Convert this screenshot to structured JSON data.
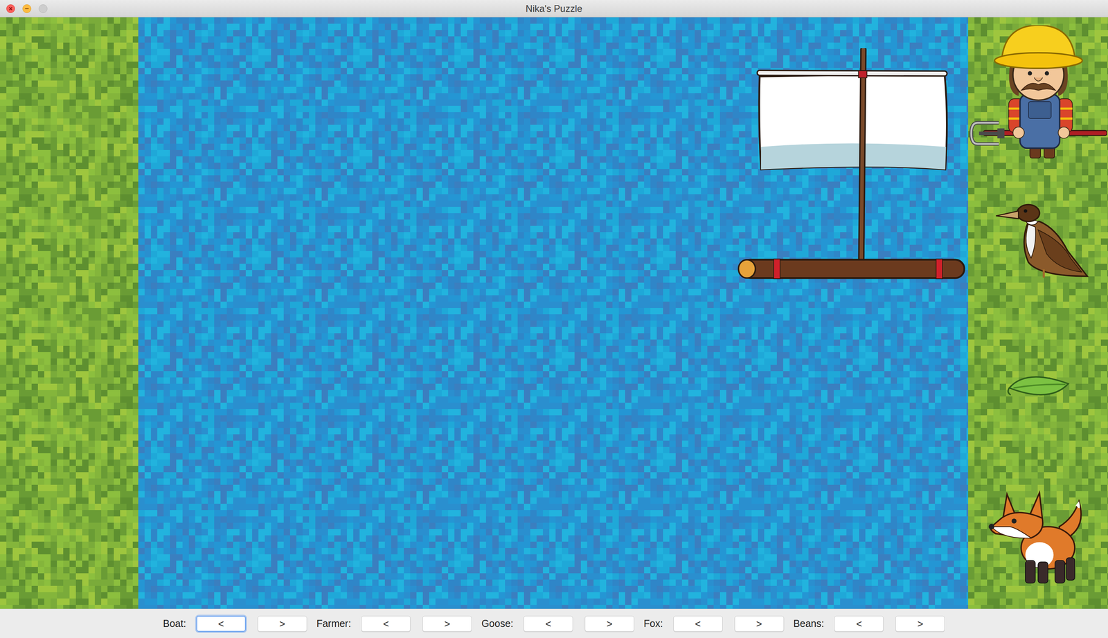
{
  "window": {
    "title": "Nika's Puzzle"
  },
  "boat": {
    "side": "right"
  },
  "entities": [
    {
      "kind": "farmer",
      "side": "right"
    },
    {
      "kind": "goose",
      "side": "right"
    },
    {
      "kind": "beans",
      "side": "right"
    },
    {
      "kind": "fox",
      "side": "right"
    }
  ],
  "toolbar": [
    {
      "label": "Boat:",
      "buttons": [
        {
          "text": "<",
          "focused": true
        },
        {
          "text": ">",
          "focused": false
        }
      ]
    },
    {
      "label": "Farmer:",
      "buttons": [
        {
          "text": "<",
          "focused": false
        },
        {
          "text": ">",
          "focused": false
        }
      ]
    },
    {
      "label": "Goose:",
      "buttons": [
        {
          "text": "<",
          "focused": false
        },
        {
          "text": ">",
          "focused": false
        }
      ]
    },
    {
      "label": "Fox:",
      "buttons": [
        {
          "text": "<",
          "focused": false
        },
        {
          "text": ">",
          "focused": false
        }
      ]
    },
    {
      "label": "Beans:",
      "buttons": [
        {
          "text": "<",
          "focused": false
        },
        {
          "text": ">",
          "focused": false
        }
      ]
    }
  ]
}
